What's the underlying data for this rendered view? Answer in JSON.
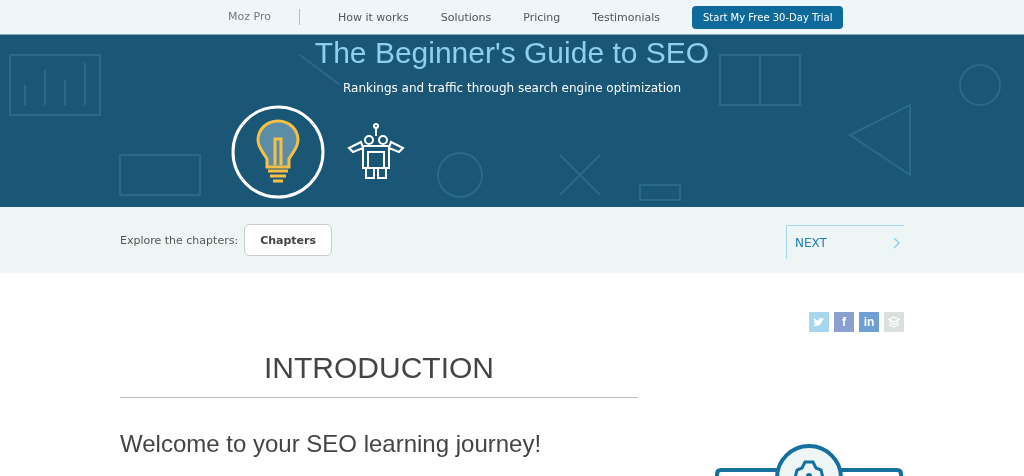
{
  "nav": {
    "brand": "Moz Pro",
    "links": [
      "How it works",
      "Solutions",
      "Pricing",
      "Testimonials"
    ],
    "cta": "Start My Free 30-Day Trial"
  },
  "hero": {
    "title": "The Beginner's Guide to SEO",
    "subtitle": "Rankings and traffic through search engine optimization"
  },
  "chapters_bar": {
    "label": "Explore the chapters:",
    "button": "Chapters",
    "next": "NEXT"
  },
  "share": [
    {
      "kind": "bird",
      "color": "#a7d6ee"
    },
    {
      "kind": "letter",
      "label": "f",
      "color": "#8b9fd0"
    },
    {
      "kind": "letter",
      "label": "in",
      "color": "#6f9fd3"
    },
    {
      "kind": "stack",
      "color": "#dadfe0"
    }
  ],
  "content": {
    "heading": "INTRODUCTION",
    "subheading": "Welcome to your SEO learning journey!"
  }
}
